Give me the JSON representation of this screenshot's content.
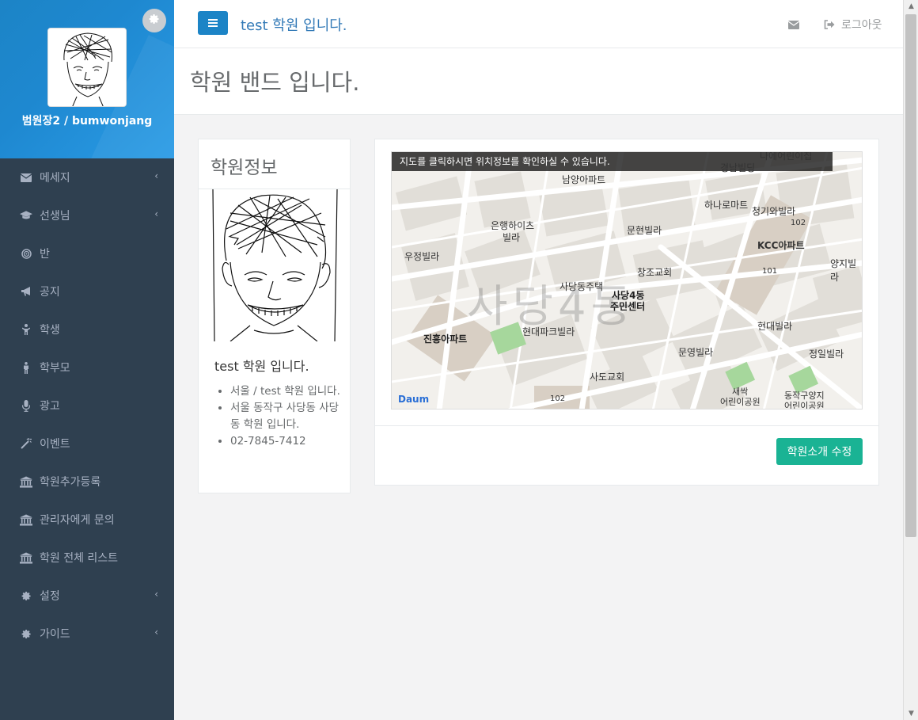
{
  "sidebar": {
    "user_name": "범원장2 / bumwonjang",
    "items": [
      {
        "label": "메세지",
        "icon": "envelope-icon",
        "has_arrow": true
      },
      {
        "label": "선생님",
        "icon": "graduation-cap-icon",
        "has_arrow": true
      },
      {
        "label": "반",
        "icon": "bullseye-icon",
        "has_arrow": false
      },
      {
        "label": "공지",
        "icon": "bullhorn-icon",
        "has_arrow": false
      },
      {
        "label": "학생",
        "icon": "child-icon",
        "has_arrow": false
      },
      {
        "label": "학부모",
        "icon": "male-icon",
        "has_arrow": false
      },
      {
        "label": "광고",
        "icon": "microphone-icon",
        "has_arrow": false
      },
      {
        "label": "이벤트",
        "icon": "magic-wand-icon",
        "has_arrow": false
      },
      {
        "label": "학원추가등록",
        "icon": "bank-icon",
        "has_arrow": false
      },
      {
        "label": "관리자에게 문의",
        "icon": "bank-icon",
        "has_arrow": false
      },
      {
        "label": "학원 전체 리스트",
        "icon": "bank-icon",
        "has_arrow": false
      },
      {
        "label": "설정",
        "icon": "cog-icon",
        "has_arrow": true
      },
      {
        "label": "가이드",
        "icon": "cog-icon",
        "has_arrow": true
      }
    ]
  },
  "topbar": {
    "title": "test 학원 입니다.",
    "logout_label": "로그아웃"
  },
  "page": {
    "heading": "학원 밴드 입니다."
  },
  "profile_card": {
    "title": "학원정보",
    "academy_name": "test 학원 입니다.",
    "details": [
      "서울 / test 학원 입니다.",
      "서울 동작구 사당동 사당동 학원 입니다.",
      "02-7845-7412"
    ]
  },
  "map_card": {
    "banner": "지도를 클릭하시면 위치정보를 확인하실 수 있습니다.",
    "area_label": "사당4동",
    "logo": "Daum",
    "places": [
      "남양아파트",
      "경남빌딩",
      "하나로마트",
      "청기와빌라",
      "은행하이츠",
      "빌라",
      "문현빌라",
      "KCC아파트",
      "우정빌라",
      "양지빌라",
      "사당동주택",
      "창조교회",
      "사당4동",
      "주민센터",
      "현대파크빌라",
      "현대빌라",
      "진흥아파트",
      "문영빌라",
      "정일빌라",
      "사도교회",
      "새싹",
      "어린이공원",
      "동작구양지",
      "어린이공원",
      "102",
      "101",
      "102",
      "나에어린이집"
    ],
    "edit_button": "학원소개 수정"
  },
  "colors": {
    "sidebar_bg": "#2f4050",
    "sidebar_header": "#1c84c6",
    "primary": "#1c84c6",
    "success": "#1ab394"
  }
}
